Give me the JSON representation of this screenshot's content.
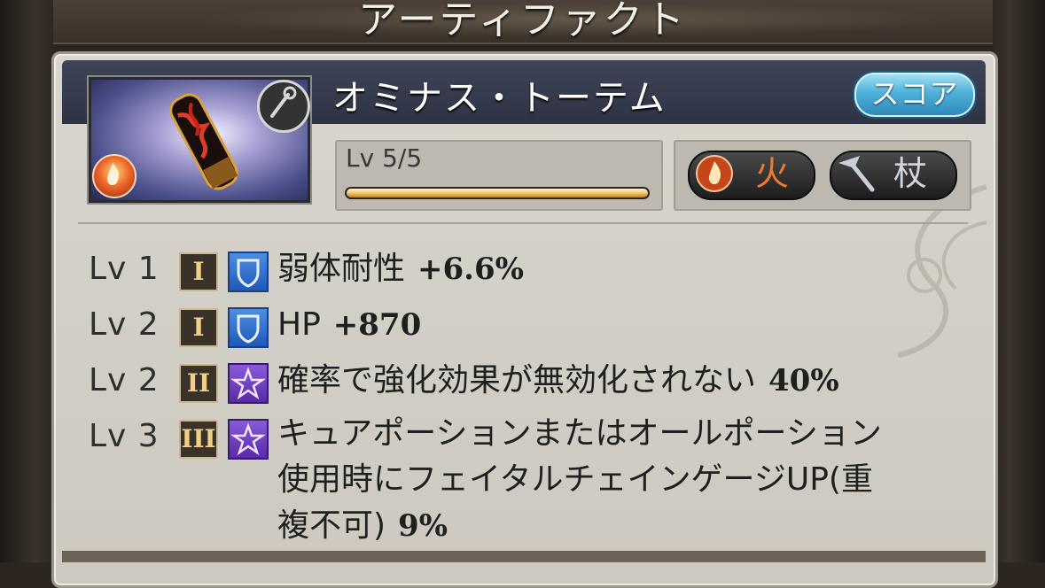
{
  "window": {
    "title": "アーティファクト"
  },
  "artifact": {
    "name": "オミナス・トーテム",
    "score_label": "スコア",
    "level_text": "Lv 5/5",
    "level_progress": 1.0,
    "element_tag": "火",
    "weapon_tag": "杖",
    "element_icon": "fire-element-icon",
    "weapon_icon": "staff-icon"
  },
  "skills": [
    {
      "level": "Lv 1",
      "tier": "I",
      "category_icon": "shield-icon",
      "text": "弱体耐性",
      "value": "+6.6%"
    },
    {
      "level": "Lv 2",
      "tier": "I",
      "category_icon": "shield-icon",
      "text": "HP",
      "value": "+870"
    },
    {
      "level": "Lv 2",
      "tier": "II",
      "category_icon": "star-icon",
      "text": "確率で強化効果が無効化されない",
      "value": "40%"
    },
    {
      "level": "Lv 3",
      "tier": "III",
      "category_icon": "star-icon",
      "text_lines": [
        "キュアポーションまたはオールポーション",
        "使用時にフェイタルチェインゲージUP(重",
        "複不可)"
      ],
      "value": "9%"
    }
  ],
  "colors": {
    "panel": "#d6d3cc",
    "header": "#353a4c",
    "score_button": "#4fb2d9",
    "fire_text": "#f07a2c",
    "staff_text": "#cfd6dc",
    "tier_gold": "#f0d088"
  }
}
